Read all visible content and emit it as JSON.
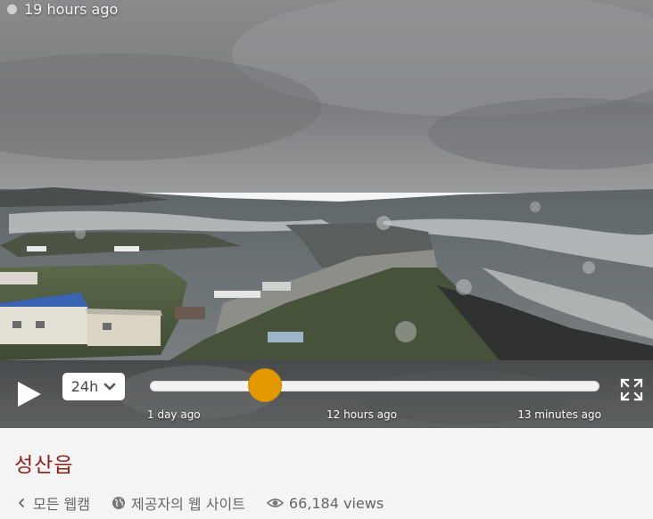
{
  "camera": {
    "timestamp": "19 hours ago",
    "title": "성산읍"
  },
  "controls": {
    "range_label": "24h",
    "ticks": [
      "1 day ago",
      "12 hours ago",
      "13 minutes ago"
    ],
    "timeline_position": 0.255
  },
  "links": {
    "all_webcams": "모든 웹캠",
    "provider_website": "제공자의 웹 사이트",
    "views": "66,184 views"
  },
  "colors": {
    "accent": "#e39a00",
    "title": "#8f1f16",
    "link_text": "#666666"
  },
  "icons": [
    "play-icon",
    "chevron-down-icon",
    "fullscreen-icon",
    "chevron-left-icon",
    "globe-icon",
    "eye-icon"
  ]
}
